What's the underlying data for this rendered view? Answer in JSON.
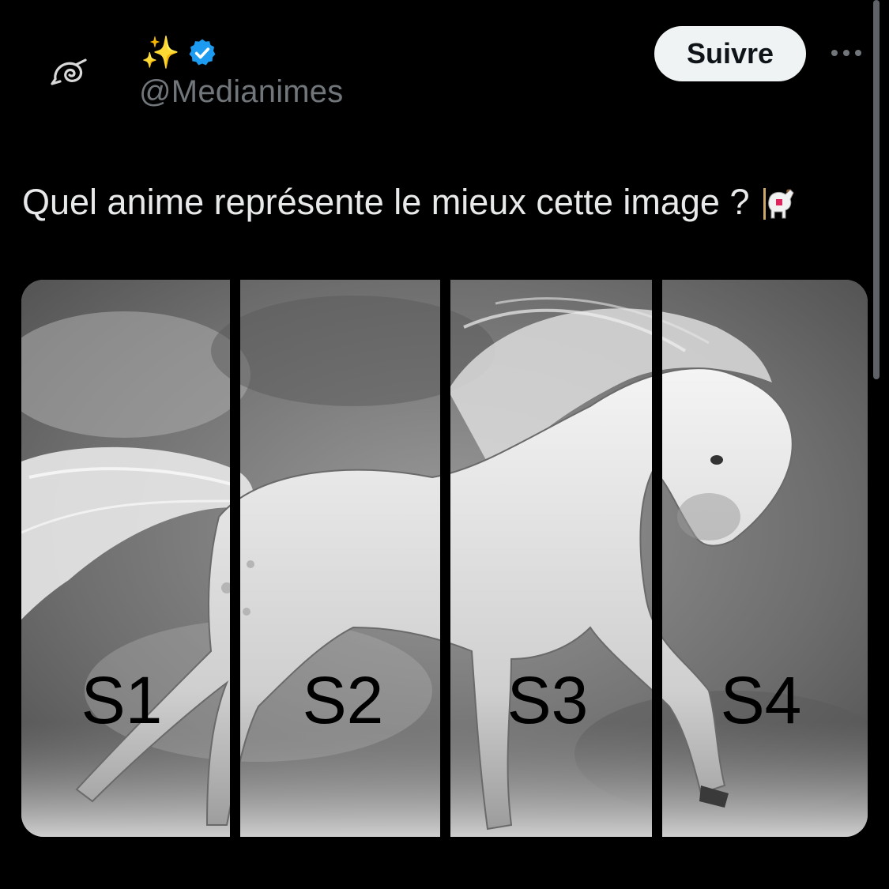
{
  "header": {
    "avatar_icon": "leaf-village-symbol-icon",
    "display_name_emoji": "✨",
    "verified_icon": "verified-badge-icon",
    "verified_color": "#1d9bf0",
    "handle": "@Medianimes",
    "follow_label": "Suivre",
    "more_icon": "more-options-icon"
  },
  "tweet": {
    "text": "Quel anime représente le mieux cette image ?",
    "emoji_icon": "carousel-horse-icon"
  },
  "media": {
    "panels": [
      {
        "label": "S1"
      },
      {
        "label": "S2"
      },
      {
        "label": "S3"
      },
      {
        "label": "S4"
      }
    ]
  },
  "colors": {
    "background": "#000000",
    "text": "#e7e9ea",
    "muted": "#71767b",
    "button_bg": "#eff3f4"
  }
}
